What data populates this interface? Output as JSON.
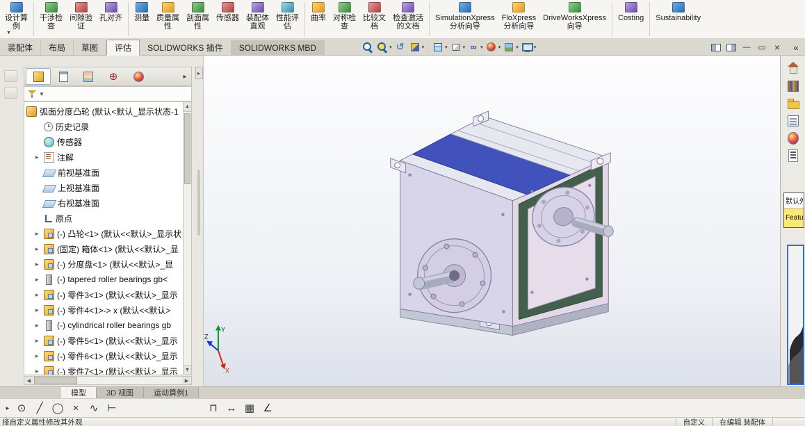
{
  "ribbon": {
    "tabs": [
      {
        "name": "assembly",
        "label": "装配体",
        "active": false,
        "shaded": false
      },
      {
        "name": "layout",
        "label": "布局",
        "active": false,
        "shaded": false
      },
      {
        "name": "sketch",
        "label": "草图",
        "active": false,
        "shaded": false
      },
      {
        "name": "evaluate",
        "label": "评估",
        "active": true,
        "shaded": false
      },
      {
        "name": "solidworks-addins",
        "label": "SOLIDWORKS 插件",
        "active": false,
        "shaded": false
      },
      {
        "name": "solidworks-mbd",
        "label": "SOLIDWORKS MBD",
        "active": false,
        "shaded": true
      }
    ]
  },
  "commandbar": {
    "buttons": [
      {
        "name": "design-study",
        "line1": "设计算",
        "line2": "例",
        "flyout": true
      },
      {
        "sep": true
      },
      {
        "name": "interference-detection",
        "line1": "干涉检",
        "line2": "查"
      },
      {
        "name": "clearance-verification",
        "line1": "间隙验",
        "line2": "证"
      },
      {
        "name": "hole-alignment",
        "line1": "孔对齐",
        "line2": ""
      },
      {
        "sep": true
      },
      {
        "name": "measure",
        "line1": "测量",
        "line2": ""
      },
      {
        "name": "mass-properties",
        "line1": "质量属",
        "line2": "性"
      },
      {
        "name": "section-properties",
        "line1": "剖面属",
        "line2": "性"
      },
      {
        "name": "sensor",
        "line1": "传感器",
        "line2": ""
      },
      {
        "name": "assembly-visualization",
        "line1": "装配体",
        "line2": "直观"
      },
      {
        "name": "performance-evaluation",
        "line1": "性能评",
        "line2": "估"
      },
      {
        "sep": true
      },
      {
        "name": "curvature",
        "line1": "曲率",
        "line2": ""
      },
      {
        "name": "symmetry-check",
        "line1": "对称检",
        "line2": "查"
      },
      {
        "name": "compare-documents",
        "line1": "比较文",
        "line2": "档"
      },
      {
        "name": "check-active-document",
        "line1": "检查激活",
        "line2": "的文档"
      },
      {
        "sep": true
      },
      {
        "name": "simulationxpress",
        "line1": "SimulationXpress",
        "line2": "分析向导"
      },
      {
        "name": "floxpress",
        "line1": "FloXpress",
        "line2": "分析向导"
      },
      {
        "name": "driveworksxpress",
        "line1": "DriveWorksXpress",
        "line2": "向导"
      },
      {
        "sep": true
      },
      {
        "name": "costing",
        "line1": "Costing",
        "line2": ""
      },
      {
        "sep": true
      },
      {
        "name": "sustainability",
        "line1": "Sustainability",
        "line2": ""
      }
    ]
  },
  "headsup": {
    "icons": [
      {
        "name": "zoom-fit-icon",
        "dd": false
      },
      {
        "name": "zoom-area-icon",
        "dd": true
      },
      {
        "name": "previous-view-icon",
        "dd": false
      },
      {
        "name": "section-view-icon",
        "dd": true
      },
      {
        "sep": true
      },
      {
        "name": "view-orientation-icon",
        "dd": true
      },
      {
        "name": "display-style-icon",
        "dd": true
      },
      {
        "name": "hide-show-items-icon",
        "dd": true
      },
      {
        "name": "edit-appearance-icon",
        "dd": true
      },
      {
        "name": "apply-scene-icon",
        "dd": true
      },
      {
        "name": "view-settings-icon",
        "dd": true
      }
    ]
  },
  "window_controls": [
    {
      "name": "pane-left-button"
    },
    {
      "name": "pane-right-button"
    },
    {
      "name": "minimize-button"
    },
    {
      "name": "maximize-button"
    },
    {
      "name": "close-button"
    }
  ],
  "taskpane": {
    "collapse_glyph": "«",
    "tabs": [
      "solidworks-resources",
      "design-library",
      "file-explorer",
      "view-palette",
      "appearances",
      "custom-properties"
    ],
    "appearance_popup": {
      "line1": "默认外",
      "line2": "Featur"
    }
  },
  "feature_tree": {
    "tabs": [
      "featuremanager-tab",
      "propertymanager-tab",
      "configurationmanager-tab",
      "dimxpertmanager-tab",
      "displaymanager-tab"
    ],
    "overflow_glyph": "▸",
    "root": {
      "label": "弧面分度凸轮 (默认<默认_显示状态-1"
    },
    "items": [
      {
        "icon": "history",
        "label": "历史记录",
        "arrow": false
      },
      {
        "icon": "sensor",
        "label": "传感器",
        "arrow": false
      },
      {
        "icon": "ann",
        "label": "注解",
        "arrow": true
      },
      {
        "icon": "plane",
        "label": "前视基准面",
        "arrow": false
      },
      {
        "icon": "plane",
        "label": "上视基准面",
        "arrow": false
      },
      {
        "icon": "plane",
        "label": "右视基准面",
        "arrow": false
      },
      {
        "icon": "origin",
        "label": "原点",
        "arrow": false
      },
      {
        "icon": "part",
        "label": "(-) 凸轮<1> (默认<<默认>_显示状",
        "arrow": true
      },
      {
        "icon": "part",
        "label": "(固定) 箱体<1> (默认<<默认>_显",
        "arrow": true
      },
      {
        "icon": "part",
        "label": "(-) 分度盘<1> (默认<<默认>_显",
        "arrow": true
      },
      {
        "icon": "bolt",
        "label": "(-) tapered roller bearings gb<",
        "arrow": true
      },
      {
        "icon": "part",
        "label": "(-) 零件3<1> (默认<<默认>_显示",
        "arrow": true
      },
      {
        "icon": "part",
        "label": "(-) 零件4<1>-> x (默认<<默认>",
        "arrow": true
      },
      {
        "icon": "bolt",
        "label": "(-) cylindrical roller bearings gb",
        "arrow": true
      },
      {
        "icon": "part",
        "label": "(-) 零件5<1> (默认<<默认>_显示",
        "arrow": true
      },
      {
        "icon": "part",
        "label": "(-) 零件6<1> (默认<<默认>_显示",
        "arrow": true
      },
      {
        "icon": "part",
        "label": "(-) 零件7<1> (默认<<默认>_显示",
        "arrow": true
      }
    ]
  },
  "doc_tabs": [
    {
      "name": "model",
      "label": "模型",
      "active": true
    },
    {
      "name": "3d-views",
      "label": "3D 视图",
      "active": false
    },
    {
      "name": "motion-study-1",
      "label": "运动算例1",
      "active": false
    }
  ],
  "bottom_tools": [
    {
      "name": "flyout-arrow",
      "glyph": "▸"
    },
    {
      "name": "circle-point-tool",
      "glyph": "⊙"
    },
    {
      "name": "line-tool",
      "glyph": "╱"
    },
    {
      "name": "circle-tool",
      "glyph": "◯"
    },
    {
      "name": "point-cross-tool",
      "glyph": "×"
    },
    {
      "name": "spline-tool",
      "glyph": "∿"
    },
    {
      "name": "trim-tool",
      "glyph": "⊢"
    },
    {
      "spacer": true
    },
    {
      "name": "slot-tool",
      "glyph": "⊓"
    },
    {
      "name": "dimension-tool",
      "glyph": "↔"
    },
    {
      "name": "grid-tool",
      "glyph": "▦"
    },
    {
      "name": "angle-tool",
      "glyph": "∠"
    }
  ],
  "statusbar": {
    "left": "择自定义属性修改其外观",
    "custom": "自定义",
    "mode": "在编辑 装配体"
  },
  "triad": {
    "x": "X",
    "y": "Y",
    "z": "Z"
  },
  "model": {
    "colors": {
      "front": "#d8d4e9",
      "side": "#e2d8e6",
      "top_panel": "#4152bd",
      "gasket": "#42604b",
      "plate": "#e6e8f0",
      "base": "#c3c6d4"
    }
  }
}
